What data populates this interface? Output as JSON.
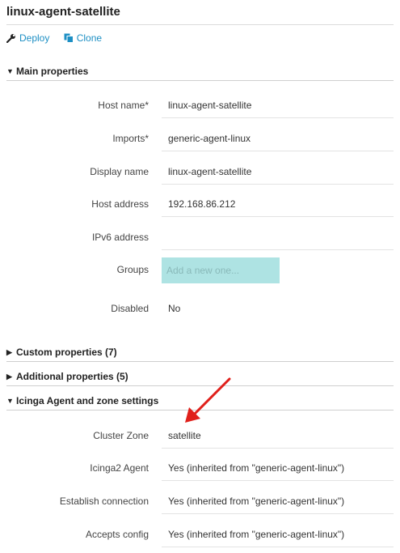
{
  "page": {
    "title": "linux-agent-satellite"
  },
  "actions": {
    "deploy_label": "Deploy",
    "clone_label": "Clone",
    "link_color": "#1d8fc4"
  },
  "sections": {
    "main": "Main properties",
    "custom": "Custom properties (7)",
    "additional": "Additional properties (5)",
    "agent": "Icinga Agent and zone settings"
  },
  "main_fields": [
    {
      "label": "Host name*",
      "value": "linux-agent-satellite"
    },
    {
      "label": "Imports*",
      "value": "generic-agent-linux"
    },
    {
      "label": "Display name",
      "value": "linux-agent-satellite"
    },
    {
      "label": "Host address",
      "value": "192.168.86.212"
    },
    {
      "label": "IPv6 address",
      "value": ""
    },
    {
      "label": "Groups",
      "placeholder": "Add a new one..."
    },
    {
      "label": "Disabled",
      "value": "No"
    }
  ],
  "agent_fields": [
    {
      "label": "Cluster Zone",
      "value": "satellite"
    },
    {
      "label": "Icinga2 Agent",
      "value": "Yes (inherited from \"generic-agent-linux\")"
    },
    {
      "label": "Establish connection",
      "value": "Yes (inherited from \"generic-agent-linux\")"
    },
    {
      "label": "Accepts config",
      "value": "Yes (inherited from \"generic-agent-linux\")"
    }
  ],
  "colors": {
    "groups_input_bg": "#aee3e3",
    "annotation_arrow": "#e0201b"
  }
}
